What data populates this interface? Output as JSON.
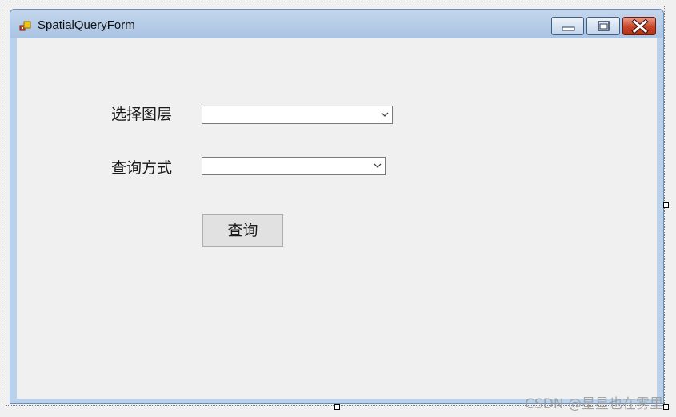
{
  "window": {
    "title": "SpatialQueryForm",
    "icon": "winforms-form-icon",
    "controls": [
      "minimize-icon",
      "maximize-icon",
      "close-icon"
    ]
  },
  "form": {
    "layer_label": "选择图层",
    "layer_value": "",
    "method_label": "查询方式",
    "method_value": "",
    "query_button_label": "查询"
  },
  "watermark": "CSDN @星星也在雾里",
  "colors": {
    "titlebar": "#b9d1ea",
    "client_background": "#f0f0f0",
    "close_button": "#c8462a"
  }
}
